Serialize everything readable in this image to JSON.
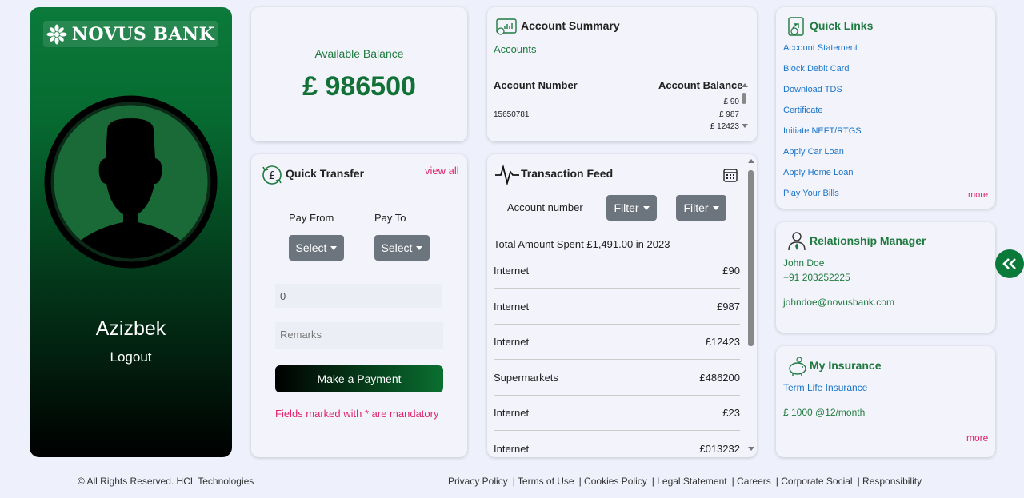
{
  "brand": {
    "name": "NOVUS BANK"
  },
  "user": {
    "name": "Azizbek",
    "logout_label": "Logout"
  },
  "balance": {
    "label": "Available Balance",
    "value": "£ 986500"
  },
  "quick_transfer": {
    "title": "Quick Transfer",
    "view_all": "view all",
    "pay_from_label": "Pay From",
    "pay_to_label": "Pay To",
    "pay_from_value": "Select",
    "pay_to_value": "Select",
    "amount_value": "0",
    "remarks_placeholder": "Remarks",
    "submit_label": "Make a Payment",
    "mandatory_note": "Fields marked with * are mandatory"
  },
  "account_summary": {
    "title": "Account Summary",
    "subtitle": "Accounts",
    "columns": [
      "Account Number",
      "Account Balance"
    ],
    "account_number": "15650781",
    "balances": [
      "£ 90",
      "£ 987",
      "£ 12423"
    ]
  },
  "transaction_feed": {
    "title": "Transaction Feed",
    "account_label": "Account number",
    "filter1": "Filter",
    "filter2": "Filter",
    "total_text": "Total Amount Spent £1,491.00 in 2023",
    "rows": [
      {
        "category": "Internet",
        "amount": "£90"
      },
      {
        "category": "Internet",
        "amount": "£987"
      },
      {
        "category": "Internet",
        "amount": "£12423"
      },
      {
        "category": "Supermarkets",
        "amount": "£486200"
      },
      {
        "category": "Internet",
        "amount": "£23"
      },
      {
        "category": "Internet",
        "amount": "£013232"
      }
    ]
  },
  "quick_links": {
    "title": "Quick Links",
    "items": [
      "Account Statement",
      "Block Debit Card",
      "Download TDS",
      "Certificate",
      "Initiate NEFT/RTGS",
      "Apply Car Loan",
      "Apply Home Loan",
      "Play Your Bills"
    ],
    "more": "more"
  },
  "relationship_manager": {
    "title": "Relationship Manager",
    "name": "John Doe",
    "phone": "+91 203252225",
    "email": "johndoe@novusbank.com"
  },
  "insurance": {
    "title": "My Insurance",
    "plan": "Term Life Insurance",
    "premium": "£ 1000 @12/month",
    "more": "more"
  },
  "footer": {
    "copyright": "© All Rights Reserved. HCL Technologies",
    "links": [
      "Privacy Policy",
      "| Terms of Use",
      "| Cookies Policy",
      "| Legal Statement",
      "| Careers",
      "| Corporate Social",
      "| Responsibility"
    ]
  },
  "colors": {
    "brand_green": "#0a7a3a",
    "accent_pink": "#e0246d",
    "link_blue": "#1a73c8"
  }
}
